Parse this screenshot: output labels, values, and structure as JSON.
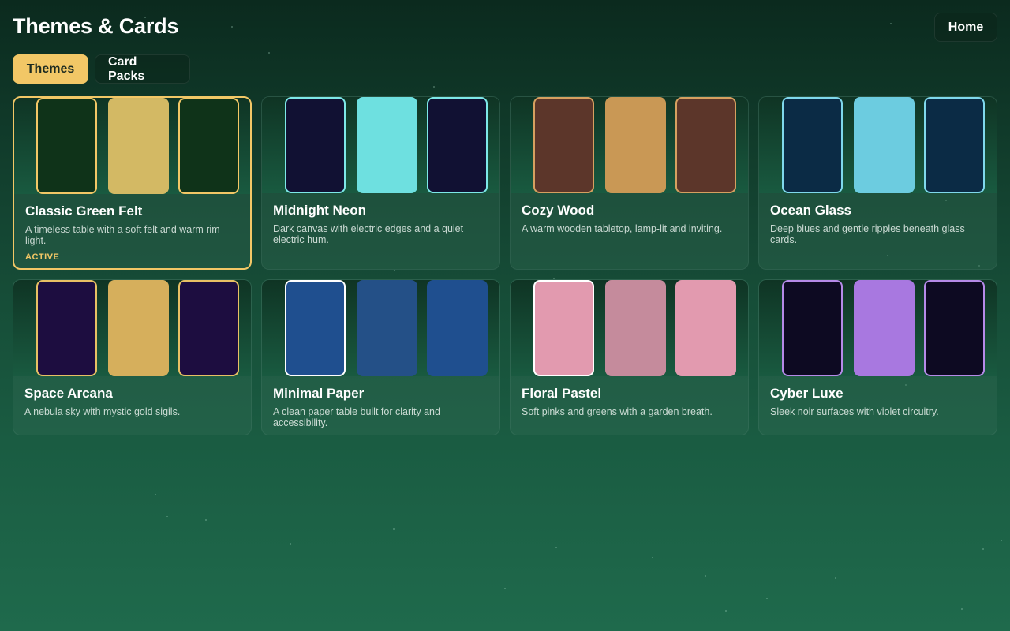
{
  "header": {
    "title": "Themes & Cards",
    "home_label": "Home"
  },
  "tabs": [
    {
      "label": "Themes",
      "selected": true
    },
    {
      "label": "Card Packs",
      "selected": false
    }
  ],
  "themes": [
    {
      "name": "Classic Green Felt",
      "description": "A timeless table with a soft felt and warm rim light.",
      "badge": "ACTIVE",
      "active": true,
      "card_colors": [
        "#0f3319",
        "#d3b964",
        "#0f3319"
      ],
      "border_color": "#f2c766"
    },
    {
      "name": "Midnight Neon",
      "description": "Dark canvas with electric edges and a quiet electric hum.",
      "card_colors": [
        "#111133",
        "#6ee0e0",
        "#111133"
      ],
      "border_color": "#7de8e8"
    },
    {
      "name": "Cozy Wood",
      "description": "A warm wooden tabletop, lamp-lit and inviting.",
      "card_colors": [
        "#5c362a",
        "#c99855",
        "#5c362a"
      ],
      "border_color": "#d6a060"
    },
    {
      "name": "Ocean Glass",
      "description": "Deep blues and gentle ripples beneath glass cards.",
      "card_colors": [
        "#0b2b45",
        "#6ccce0",
        "#0b2b45"
      ],
      "border_color": "#7fd8ec"
    },
    {
      "name": "Space Arcana",
      "description": "A nebula sky with mystic gold sigils.",
      "card_colors": [
        "#1d0d40",
        "#d6af5c",
        "#1d0d40"
      ],
      "border_color": "#e8c064"
    },
    {
      "name": "Minimal Paper",
      "description": "A clean paper table built for clarity and accessibility.",
      "card_colors": [
        "#1f4f8f",
        "#245087",
        "#1f4f8f"
      ],
      "border_color": "#ffffff"
    },
    {
      "name": "Floral Pastel",
      "description": "Soft pinks and greens with a garden breath.",
      "card_colors": [
        "#e29aaf",
        "#c58b9c",
        "#e29aaf"
      ],
      "border_color": "#ffffff"
    },
    {
      "name": "Cyber Luxe",
      "description": "Sleek noir surfaces with violet circuitry.",
      "card_colors": [
        "#0d0a22",
        "#a878e0",
        "#0d0a22"
      ],
      "border_color": "#b58ae8"
    }
  ]
}
